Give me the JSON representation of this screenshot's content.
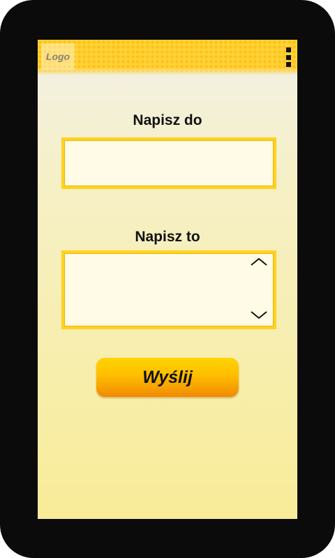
{
  "header": {
    "logo_text": "Logo",
    "menu_icon": "vertical-dots-menu-icon"
  },
  "form": {
    "recipient_label": "Napisz do",
    "recipient_value": "",
    "recipient_placeholder": "",
    "message_label": "Napisz to",
    "message_value": "",
    "message_placeholder": "",
    "scroll_up_icon": "chevron-up-icon",
    "scroll_down_icon": "chevron-down-icon",
    "send_label": "Wyślij"
  },
  "colors": {
    "accent": "#ffd21f",
    "button_top": "#ffd400",
    "button_bottom": "#f08a00",
    "device_frame": "#0b0b0b"
  }
}
